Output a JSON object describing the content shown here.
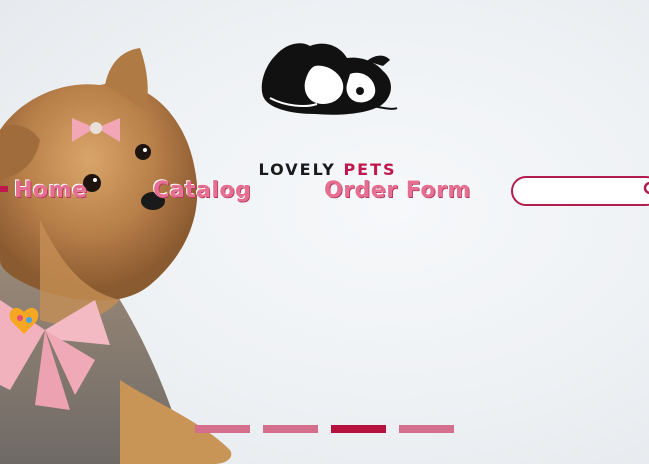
{
  "brand": {
    "name_part1": "LOVELY",
    "name_part2": "PETS"
  },
  "nav": {
    "items": [
      {
        "label": "Home"
      },
      {
        "label": "Catalog"
      },
      {
        "label": "Order Form"
      }
    ]
  },
  "search": {
    "placeholder": "",
    "value": ""
  },
  "slider": {
    "count": 4,
    "active_index": 2
  },
  "colors": {
    "accent": "#c0184c",
    "nav_text": "#e56f91",
    "dot": "#d36f8d",
    "dot_active": "#b5123f"
  }
}
